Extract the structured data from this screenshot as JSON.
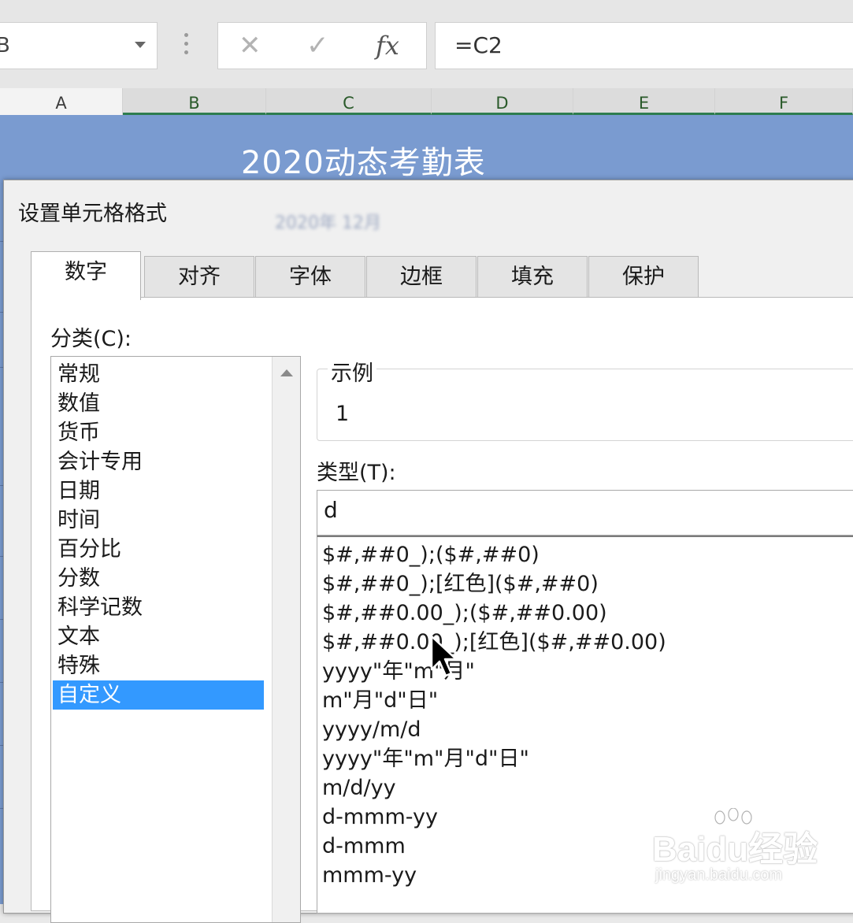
{
  "formula_bar": {
    "name_box_value": "B",
    "cancel_glyph": "✕",
    "enter_glyph": "✓",
    "fx_label": "fx",
    "formula": "=C2"
  },
  "columns": [
    {
      "label": "A",
      "selected": false
    },
    {
      "label": "B",
      "selected": true
    },
    {
      "label": "C",
      "selected": true
    },
    {
      "label": "D",
      "selected": true
    },
    {
      "label": "E",
      "selected": true
    },
    {
      "label": "F",
      "selected": true
    }
  ],
  "sheet": {
    "title": "2020动态考勤表",
    "subtitle_ghost": "2020年 12月"
  },
  "dialog": {
    "title": "设置单元格格式",
    "tabs": [
      "数字",
      "对齐",
      "字体",
      "边框",
      "填充",
      "保护"
    ],
    "active_tab": "数字",
    "category_label": "分类(C):",
    "categories": [
      "常规",
      "数值",
      "货币",
      "会计专用",
      "日期",
      "时间",
      "百分比",
      "分数",
      "科学记数",
      "文本",
      "特殊",
      "自定义"
    ],
    "selected_category": "自定义",
    "sample_label": "示例",
    "sample_value": "1",
    "type_label": "类型(T):",
    "type_value": "d",
    "format_list": [
      "$#,##0_);($#,##0)",
      "$#,##0_);[红色]($#,##0)",
      "$#,##0.00_);($#,##0.00)",
      "$#,##0.00_);[红色]($#,##0.00)",
      "yyyy\"年\"m\"月\"",
      "m\"月\"d\"日\"",
      "yyyy/m/d",
      "yyyy\"年\"m\"月\"d\"日\"",
      "m/d/yy",
      "d-mmm-yy",
      "d-mmm",
      "mmm-yy"
    ]
  },
  "watermark": {
    "logo": "Baidu经验",
    "url": "jingyan.baidu.com"
  },
  "colors": {
    "sheet_header_blue": "#7a9bd0",
    "selection_blue": "#3399ff",
    "column_select_green": "#2e7d4f"
  }
}
